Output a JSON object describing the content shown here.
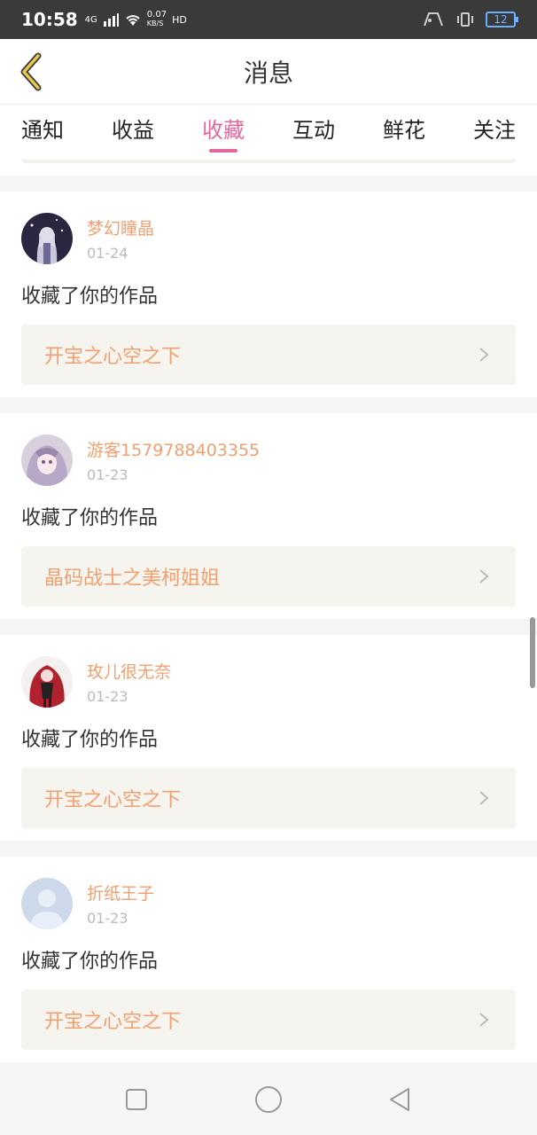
{
  "status_bar": {
    "time": "10:58",
    "network": "4G",
    "speed": "0.07",
    "speed_unit": "KB/S",
    "hd": "HD",
    "battery": "12"
  },
  "header": {
    "title": "消息"
  },
  "tabs": [
    {
      "label": "通知",
      "active": false
    },
    {
      "label": "收益",
      "active": false
    },
    {
      "label": "收藏",
      "active": true
    },
    {
      "label": "互动",
      "active": false
    },
    {
      "label": "鲜花",
      "active": false
    },
    {
      "label": "关注",
      "active": false
    }
  ],
  "messages": [
    {
      "username": "梦幻瞳晶",
      "date": "01-24",
      "action": "收藏了你的作品",
      "work": "开宝之心空之下",
      "avatar": "anime-avatar-silver"
    },
    {
      "username": "游客1579788403355",
      "date": "01-23",
      "action": "收藏了你的作品",
      "work": "晶码战士之美柯姐姐",
      "avatar": "anime-avatar-lavender"
    },
    {
      "username": "玫儿很无奈",
      "date": "01-23",
      "action": "收藏了你的作品",
      "work": "开宝之心空之下",
      "avatar": "anime-avatar-red"
    },
    {
      "username": "折纸王子",
      "date": "01-23",
      "action": "收藏了你的作品",
      "work": "开宝之心空之下",
      "avatar": "default-avatar"
    }
  ],
  "colors": {
    "accent": "#e4679f",
    "username": "#f0a070",
    "back_icon": "#e8c84a"
  }
}
